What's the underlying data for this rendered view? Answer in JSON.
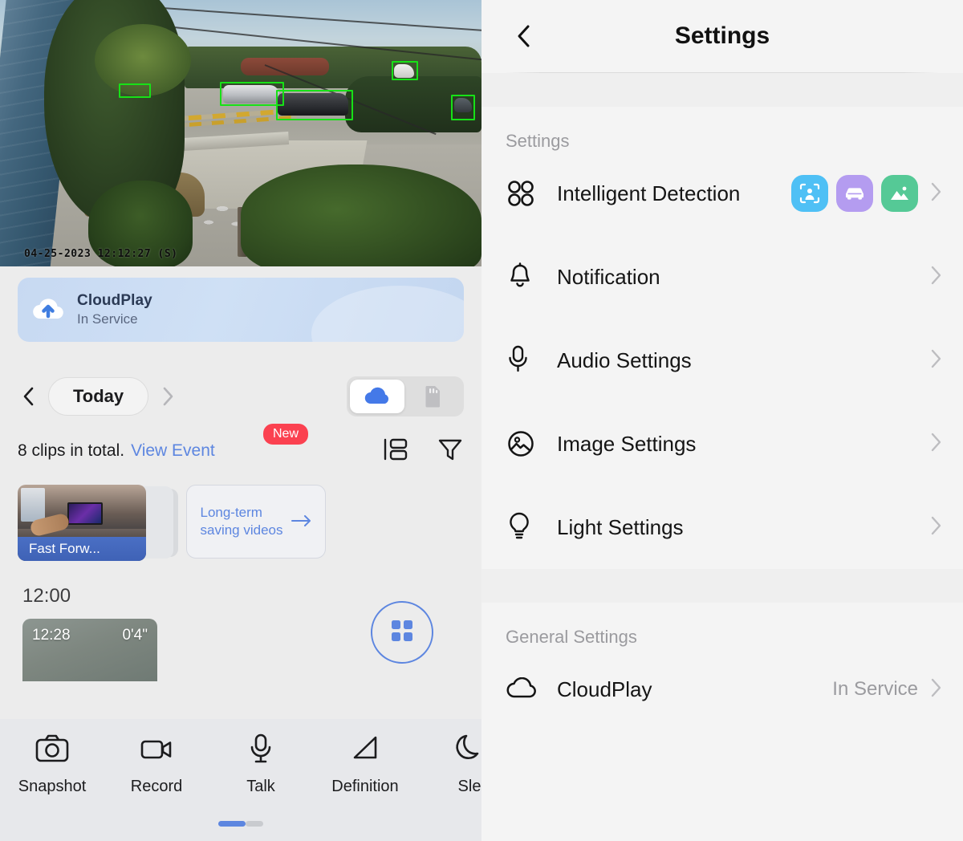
{
  "camera": {
    "timestamp": "04-25-2023 12:12:27 (S)",
    "detection_box_color": "#17e117",
    "detection_boxes": 5
  },
  "cloud_banner": {
    "icon": "cloud-upload-icon",
    "title": "CloudPlay",
    "status": "In Service"
  },
  "date_nav": {
    "prev_icon": "chevron-left-icon",
    "next_icon": "chevron-right-icon",
    "current_label": "Today",
    "sources": [
      {
        "icon": "cloud-icon",
        "selected": true
      },
      {
        "icon": "sd-card-icon",
        "selected": false
      }
    ]
  },
  "clips": {
    "total_text": "8 clips in total.",
    "view_event_label": "View Event",
    "new_badge": "New",
    "new_badge_color": "#fb4150",
    "link_color": "#5d86e0",
    "list_view_icon": "list-layout-icon",
    "filter_icon": "filter-icon"
  },
  "thumbnails": {
    "fast_forward_label": "Fast Forw...",
    "long_term_line1": "Long-term",
    "long_term_line2": "saving videos",
    "long_term_arrow": "arrow-right-icon"
  },
  "timeline": {
    "hour_label": "12:00",
    "clip_time": "12:28",
    "clip_duration": "0'4\"",
    "grid_fab_icon": "grid-icon",
    "grid_fab_color": "#5d86e0"
  },
  "bottom_bar": {
    "items": [
      {
        "label": "Snapshot",
        "icon": "camera-icon"
      },
      {
        "label": "Record",
        "icon": "video-camera-icon"
      },
      {
        "label": "Talk",
        "icon": "microphone-icon"
      },
      {
        "label": "Definition",
        "icon": "definition-icon"
      },
      {
        "label": "Sle",
        "icon": "moon-icon"
      }
    ],
    "page_indicator": {
      "active": 1,
      "total": 2
    }
  },
  "settings_panel": {
    "header": {
      "back_icon": "chevron-left-icon",
      "title": "Settings"
    },
    "sections": [
      {
        "label": "Settings",
        "rows": [
          {
            "icon": "four-circles-icon",
            "label": "Intelligent Detection",
            "badges": [
              {
                "name": "person-detection-badge",
                "color": "#4FC0F5"
              },
              {
                "name": "vehicle-detection-badge",
                "color": "#B49CF0"
              },
              {
                "name": "motion-detection-badge",
                "color": "#55C996"
              }
            ],
            "chevron": "chevron-right-icon"
          },
          {
            "icon": "bell-icon",
            "label": "Notification",
            "chevron": "chevron-right-icon"
          },
          {
            "icon": "microphone-icon",
            "label": "Audio Settings",
            "chevron": "chevron-right-icon"
          },
          {
            "icon": "image-icon",
            "label": "Image Settings",
            "chevron": "chevron-right-icon"
          },
          {
            "icon": "lightbulb-icon",
            "label": "Light Settings",
            "chevron": "chevron-right-icon"
          }
        ]
      },
      {
        "label": "General Settings",
        "rows": [
          {
            "icon": "cloud-icon",
            "label": "CloudPlay",
            "value": "In Service",
            "chevron": "chevron-right-icon"
          }
        ]
      }
    ]
  }
}
